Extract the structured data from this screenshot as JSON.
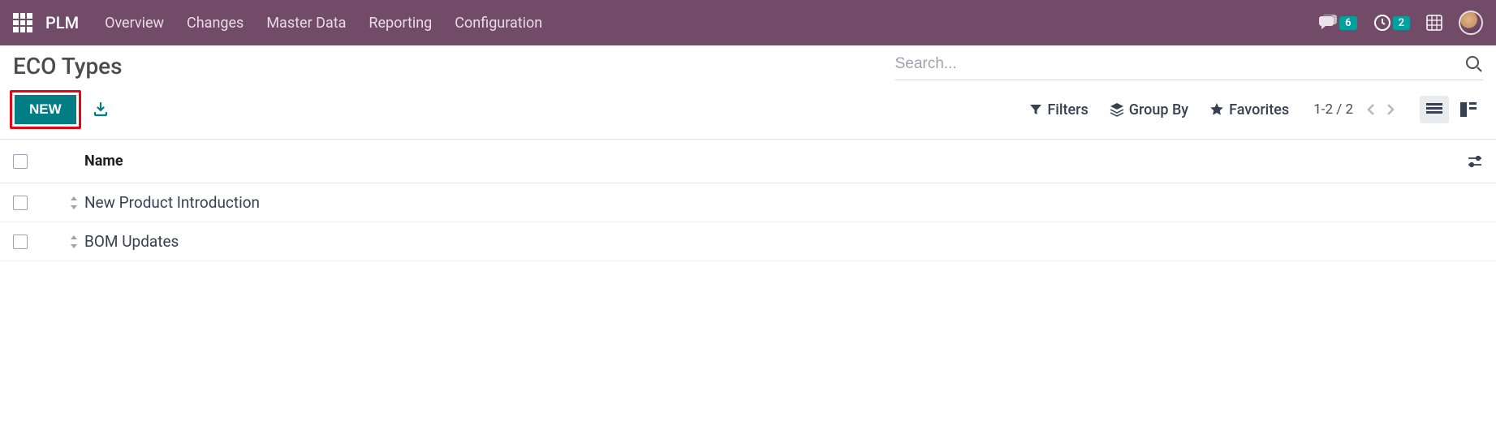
{
  "navbar": {
    "brand": "PLM",
    "menu": [
      "Overview",
      "Changes",
      "Master Data",
      "Reporting",
      "Configuration"
    ],
    "messages_badge": "6",
    "activities_badge": "2"
  },
  "breadcrumb": {
    "title": "ECO Types"
  },
  "search": {
    "placeholder": "Search..."
  },
  "toolbar": {
    "new_label": "NEW",
    "filters_label": "Filters",
    "groupby_label": "Group By",
    "favorites_label": "Favorites",
    "pager": "1-2 / 2"
  },
  "table": {
    "header_name": "Name",
    "rows": [
      {
        "name": "New Product Introduction"
      },
      {
        "name": "BOM Updates"
      }
    ]
  }
}
